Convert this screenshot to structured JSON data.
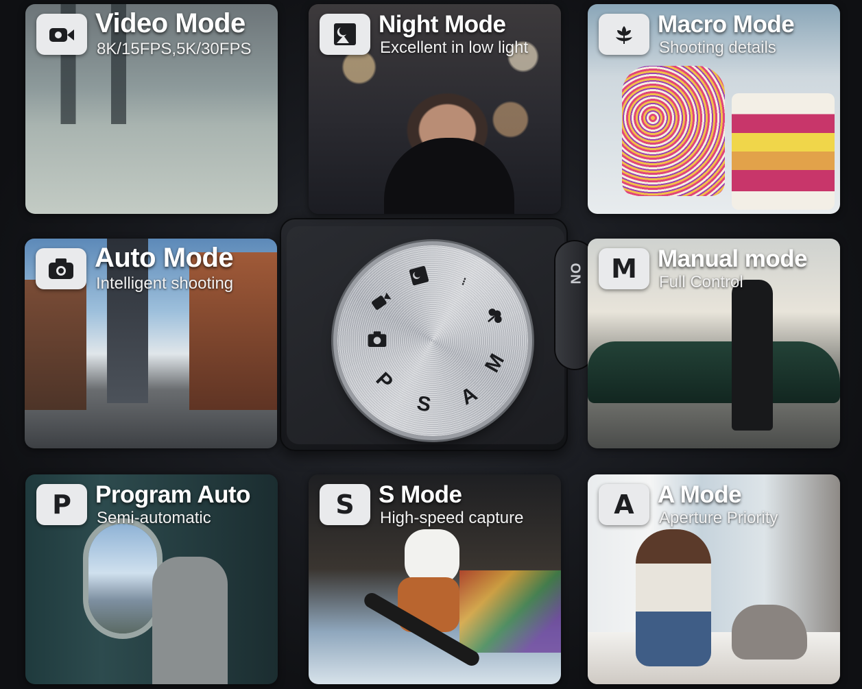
{
  "dial": {
    "power_label": "ON",
    "marks": [
      "M",
      "A",
      "S",
      "P"
    ]
  },
  "cards": [
    {
      "id": "video",
      "title": "Video Mode",
      "subtitle": "8K/15FPS,5K/30FPS",
      "icon": "video-camera-icon",
      "badge_letter": ""
    },
    {
      "id": "night",
      "title": "Night Mode",
      "subtitle": "Excellent in low light",
      "icon": "night-image-icon",
      "badge_letter": ""
    },
    {
      "id": "macro",
      "title": "Macro Mode",
      "subtitle": "Shooting details",
      "icon": "flower-icon",
      "badge_letter": ""
    },
    {
      "id": "auto",
      "title": "Auto Mode",
      "subtitle": "Intelligent shooting",
      "icon": "camera-icon",
      "badge_letter": ""
    },
    {
      "id": "manual",
      "title": "Manual mode",
      "subtitle": "Full Control",
      "icon": "",
      "badge_letter": "M"
    },
    {
      "id": "program",
      "title": "Program Auto",
      "subtitle": "Semi-automatic",
      "icon": "",
      "badge_letter": "P"
    },
    {
      "id": "shutter",
      "title": "S Mode",
      "subtitle": "High-speed capture",
      "icon": "",
      "badge_letter": "S"
    },
    {
      "id": "aperture",
      "title": "A Mode",
      "subtitle": "Aperture Priority",
      "icon": "",
      "badge_letter": "A"
    }
  ]
}
